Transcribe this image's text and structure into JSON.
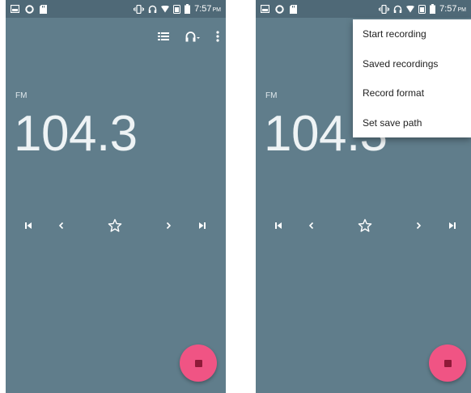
{
  "colors": {
    "background": "#607d8b",
    "status_bar": "#4f6977",
    "fab": "#f05484",
    "menu_background": "#ffffff"
  },
  "screens": [
    {
      "status_bar": {
        "time": "7:57",
        "ampm": "PM"
      },
      "band": "FM",
      "frequency": "104.3",
      "action_icons": [
        "list-icon",
        "headphones-icon",
        "overflow-menu-icon"
      ],
      "control_icons": [
        "skip-previous-icon",
        "chevron-left-icon",
        "star-outline-icon",
        "chevron-right-icon",
        "skip-next-icon"
      ]
    },
    {
      "status_bar": {
        "time": "7:57",
        "ampm": "PM"
      },
      "band": "FM",
      "frequency": "104.3",
      "menu_items": [
        "Start recording",
        "Saved recordings",
        "Record format",
        "Set save path"
      ],
      "control_icons": [
        "skip-previous-icon",
        "chevron-left-icon",
        "star-outline-icon",
        "chevron-right-icon",
        "skip-next-icon"
      ]
    }
  ]
}
